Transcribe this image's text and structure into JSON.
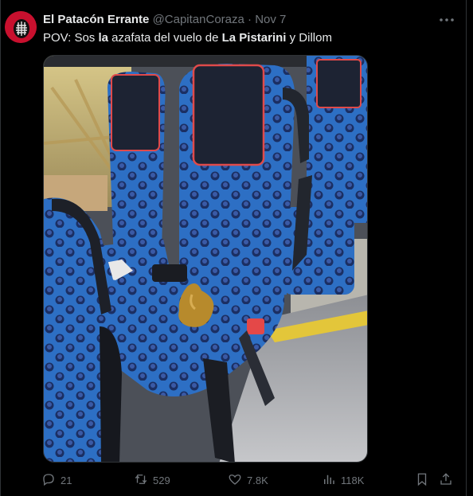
{
  "tweet": {
    "author_name": "El Patacón Errante",
    "handle": "@CapitanCoraza",
    "separator": "·",
    "date": "Nov 7",
    "text_parts": [
      "POV: Sos ",
      "la",
      " azafata del vuelo de ",
      "La Pistarini",
      " y Dillom"
    ]
  },
  "actions": {
    "replies": "21",
    "reposts": "529",
    "likes": "7.8K",
    "views": "118K"
  },
  "icons": {
    "reply": "reply-icon",
    "repost": "repost-icon",
    "like": "like-icon",
    "views": "views-icon",
    "bookmark": "bookmark-icon",
    "share": "share-icon",
    "more": "more-icon"
  },
  "colors": {
    "background": "#000000",
    "text": "#e7e9ea",
    "muted": "#71767b",
    "seat_blue": "#2d6fc4"
  }
}
